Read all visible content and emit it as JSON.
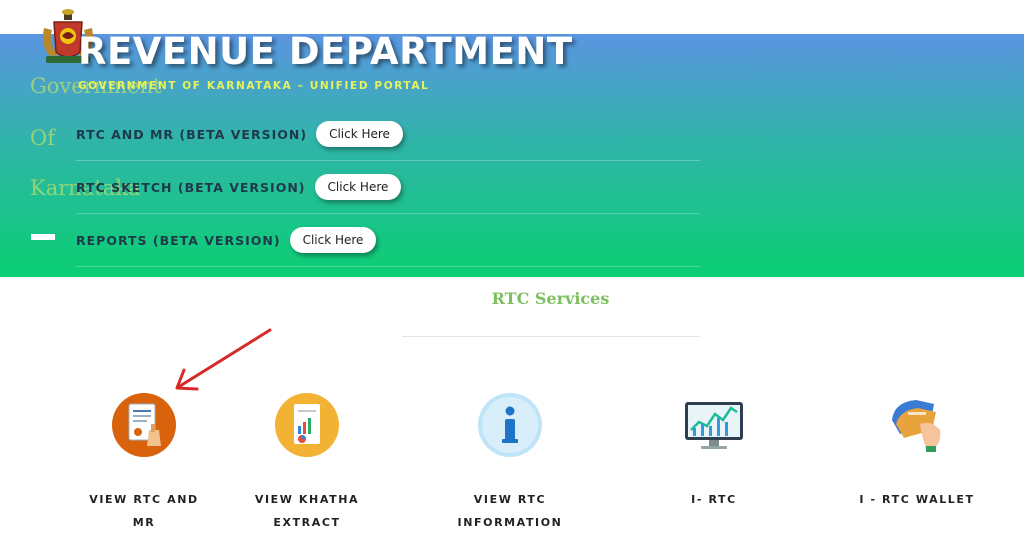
{
  "header": {
    "title": "REVENUE DEPARTMENT",
    "subtitle": "GOVERNMENT OF KARNATAKA – UNIFIED PORTAL"
  },
  "ghost_nav": [
    "Government",
    "Of",
    "Karnataka"
  ],
  "menu": [
    {
      "label": "RTC AND MR (BETA VERSION)",
      "button": "Click Here"
    },
    {
      "label": "RTC SKETCH (BETA VERSION)",
      "button": "Click Here"
    },
    {
      "label": "REPORTS (BETA VERSION)",
      "button": "Click Here"
    }
  ],
  "section": {
    "title": "RTC Services"
  },
  "services": [
    {
      "line1": "VIEW RTC AND",
      "line2": "MR",
      "icon": "document-stamp-icon"
    },
    {
      "line1": "VIEW KHATHA",
      "line2": "EXTRACT",
      "icon": "chart-report-icon"
    },
    {
      "line1": "VIEW RTC",
      "line2": "INFORMATION",
      "icon": "info-icon"
    },
    {
      "line1": "I- RTC",
      "line2": "",
      "icon": "monitor-chart-icon"
    },
    {
      "line1": "I - RTC WALLET",
      "line2": "",
      "icon": "wallet-icon"
    }
  ],
  "colors": {
    "hero_top": "#5b95e2",
    "hero_bottom": "#0bcf73",
    "section_title": "#7cbf5e",
    "annotation_arrow": "#d62a2a"
  }
}
